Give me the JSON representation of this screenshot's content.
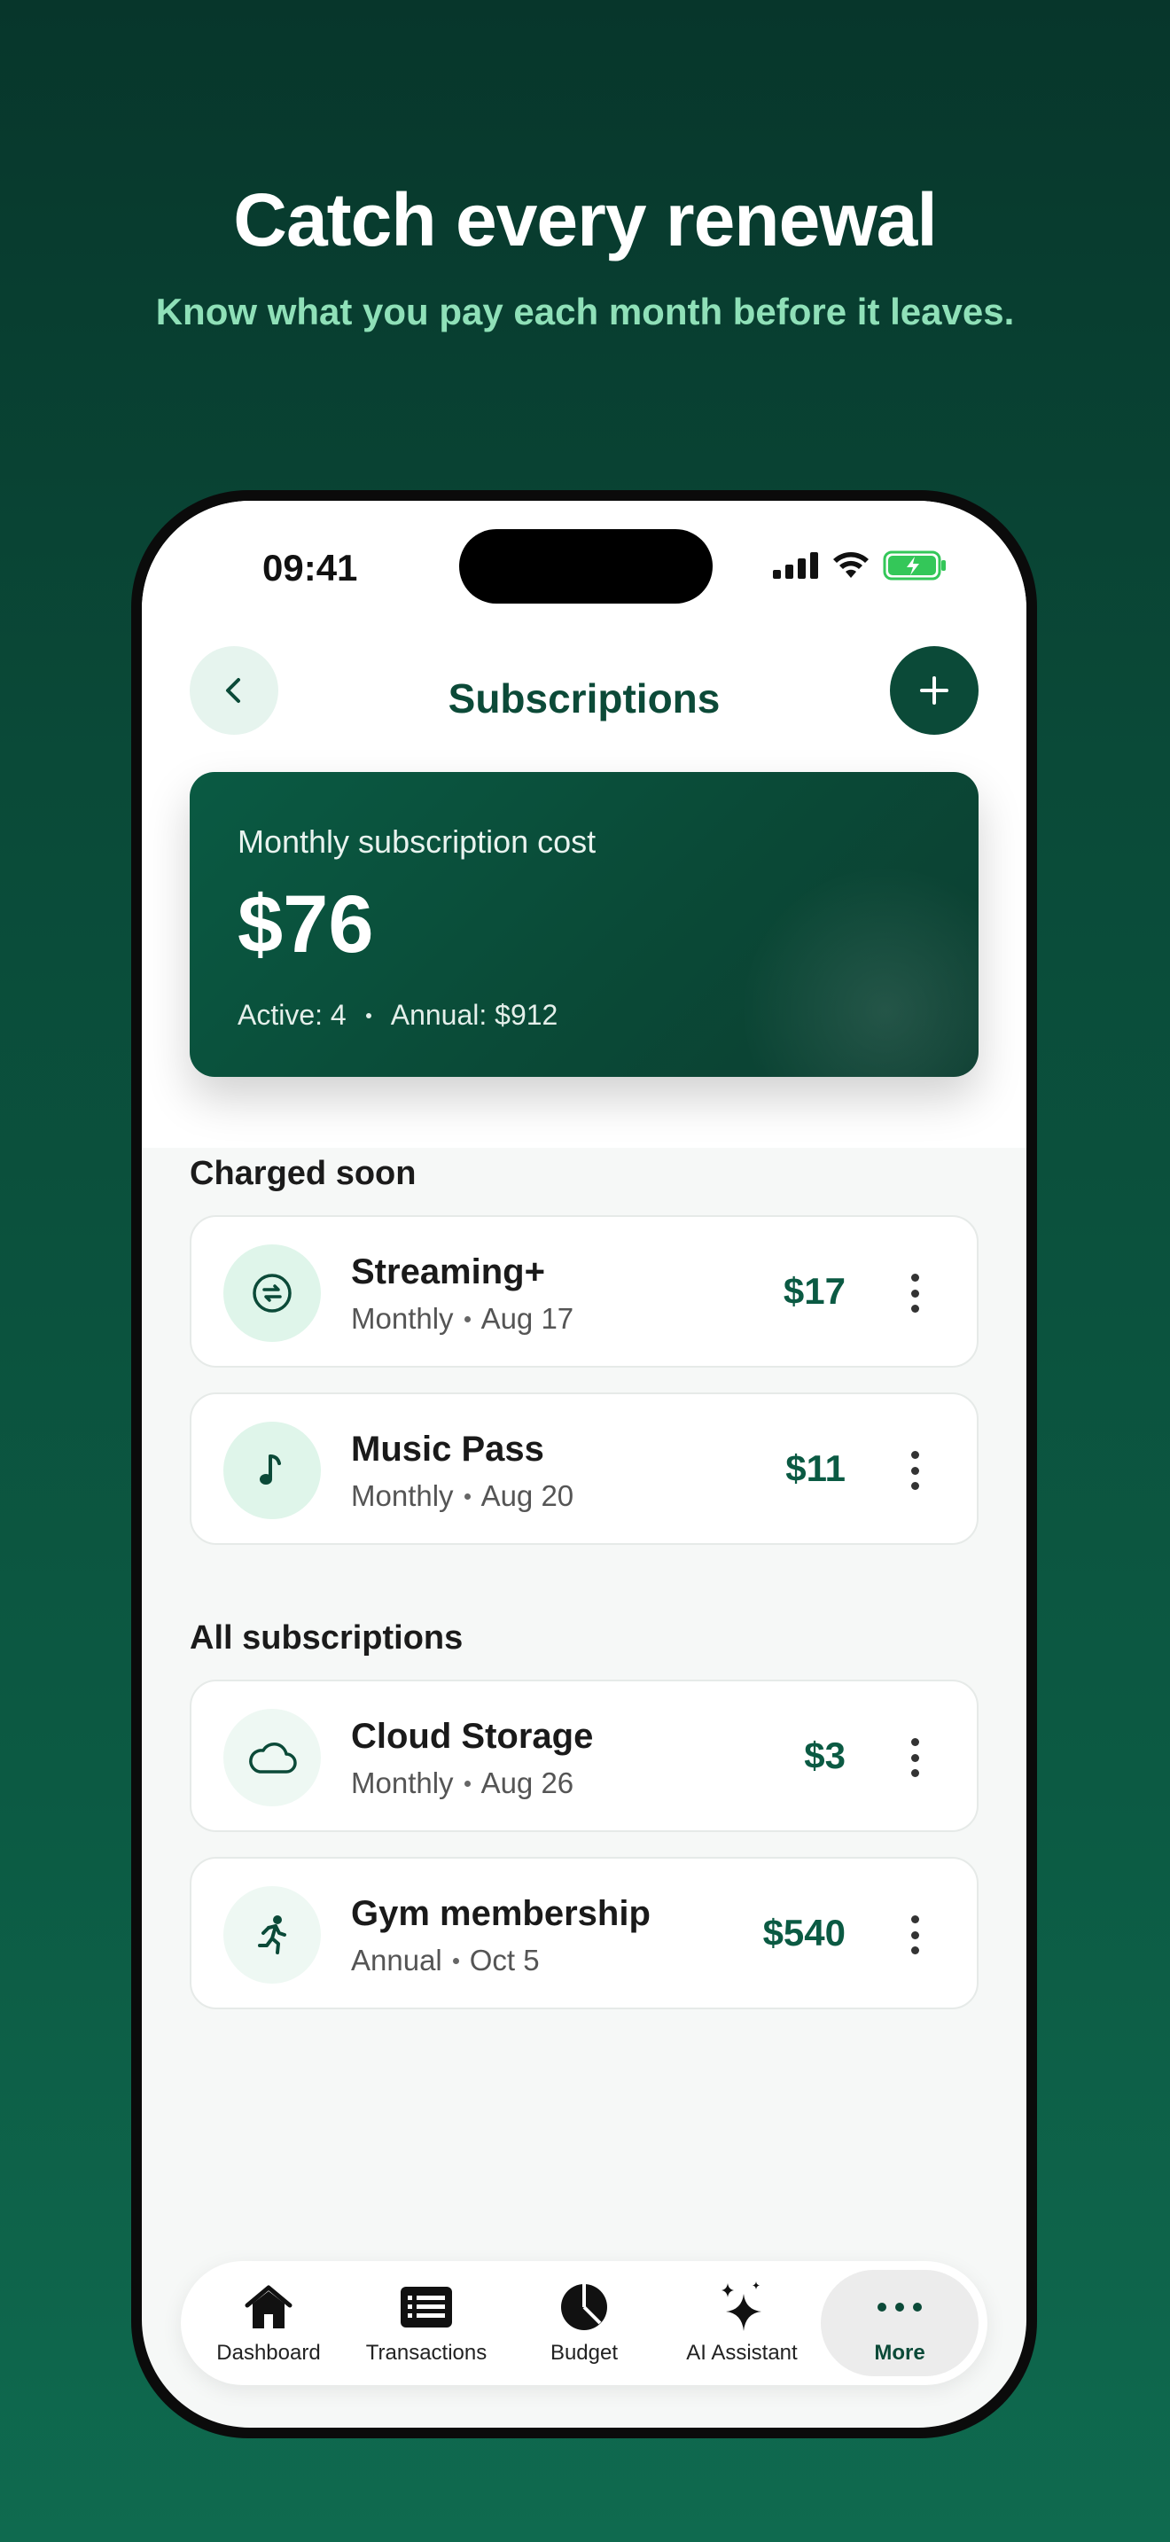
{
  "hero": {
    "title": "Catch every renewal",
    "subtitle": "Know what you pay each month before it leaves."
  },
  "status_bar": {
    "time": "09:41"
  },
  "nav": {
    "title": "Subscriptions",
    "back_icon": "chevron-left-icon",
    "add_icon": "plus-icon"
  },
  "summary": {
    "label": "Monthly subscription cost",
    "amount": "$76",
    "active": "Active: 4",
    "annual": "Annual: $912"
  },
  "sections": {
    "charged_soon": "Charged soon",
    "all": "All subscriptions"
  },
  "charged_soon": [
    {
      "name": "Streaming+",
      "cycle": "Monthly",
      "date": "Aug 17",
      "price": "$17",
      "icon": "repeat-icon"
    },
    {
      "name": "Music Pass",
      "cycle": "Monthly",
      "date": "Aug 20",
      "price": "$11",
      "icon": "music-note-icon"
    }
  ],
  "all_subscriptions": [
    {
      "name": "Cloud Storage",
      "cycle": "Monthly",
      "date": "Aug 26",
      "price": "$3",
      "icon": "cloud-icon"
    },
    {
      "name": "Gym membership",
      "cycle": "Annual",
      "date": "Oct 5",
      "price": "$540",
      "icon": "running-icon"
    }
  ],
  "tabs": [
    {
      "label": "Dashboard",
      "icon": "home-icon",
      "active": false
    },
    {
      "label": "Transactions",
      "icon": "list-icon",
      "active": false
    },
    {
      "label": "Budget",
      "icon": "pie-chart-icon",
      "active": false
    },
    {
      "label": "AI Assistant",
      "icon": "sparkle-icon",
      "active": false
    },
    {
      "label": "More",
      "icon": "more-icon",
      "active": true
    }
  ],
  "colors": {
    "brand_dark": "#0b4a38",
    "accent_light": "#8fe0b8",
    "icon_bg_soon": "#dff5ea",
    "icon_bg_all": "#eef8f3",
    "battery_green": "#34c759"
  }
}
